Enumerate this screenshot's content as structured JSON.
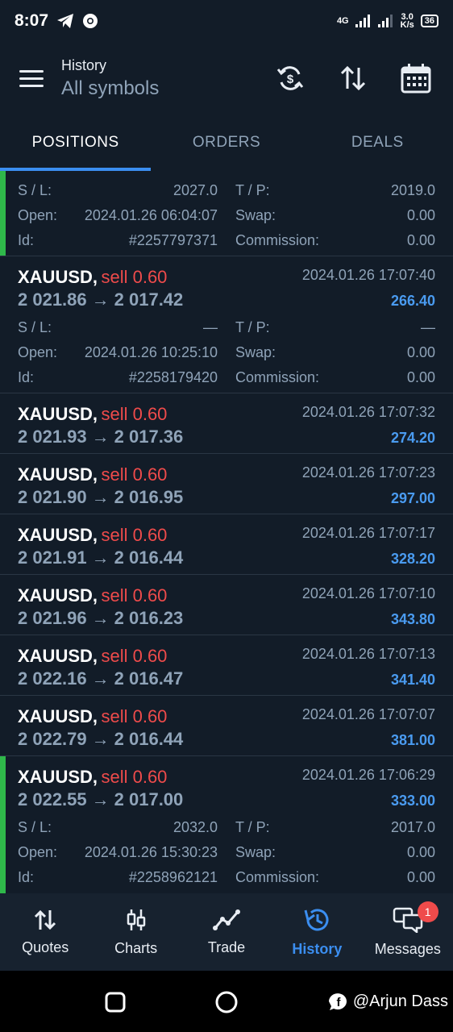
{
  "status_bar": {
    "time": "8:07",
    "network": "4G",
    "speed_value": "3.0",
    "speed_unit": "K/s",
    "battery": "36"
  },
  "header": {
    "subtitle": "History",
    "title": "All symbols"
  },
  "tabs": [
    {
      "label": "POSITIONS"
    },
    {
      "label": "ORDERS"
    },
    {
      "label": "DEALS"
    }
  ],
  "partial_row": {
    "sl_label": "S / L:",
    "sl": "2027.0",
    "tp_label": "T / P:",
    "tp": "2019.0",
    "open_label": "Open:",
    "open": "2024.01.26 06:04:07",
    "swap_label": "Swap:",
    "swap": "0.00",
    "id_label": "Id:",
    "id": "#2257797371",
    "commission_label": "Commission:",
    "commission": "0.00"
  },
  "positions": [
    {
      "symbol": "XAUUSD,",
      "side": "sell 0.60",
      "time": "2024.01.26 17:07:40",
      "open_price": "2 021.86",
      "close_price": "2 017.42",
      "profit": "266.40",
      "details": {
        "sl_label": "S / L:",
        "sl": "—",
        "tp_label": "T / P:",
        "tp": "—",
        "open_label": "Open:",
        "open": "2024.01.26 10:25:10",
        "swap_label": "Swap:",
        "swap": "0.00",
        "id_label": "Id:",
        "id": "#2258179420",
        "commission_label": "Commission:",
        "commission": "0.00"
      }
    },
    {
      "symbol": "XAUUSD,",
      "side": "sell 0.60",
      "time": "2024.01.26 17:07:32",
      "open_price": "2 021.93",
      "close_price": "2 017.36",
      "profit": "274.20"
    },
    {
      "symbol": "XAUUSD,",
      "side": "sell 0.60",
      "time": "2024.01.26 17:07:23",
      "open_price": "2 021.90",
      "close_price": "2 016.95",
      "profit": "297.00"
    },
    {
      "symbol": "XAUUSD,",
      "side": "sell 0.60",
      "time": "2024.01.26 17:07:17",
      "open_price": "2 021.91",
      "close_price": "2 016.44",
      "profit": "328.20"
    },
    {
      "symbol": "XAUUSD,",
      "side": "sell 0.60",
      "time": "2024.01.26 17:07:10",
      "open_price": "2 021.96",
      "close_price": "2 016.23",
      "profit": "343.80"
    },
    {
      "symbol": "XAUUSD,",
      "side": "sell 0.60",
      "time": "2024.01.26 17:07:13",
      "open_price": "2 022.16",
      "close_price": "2 016.47",
      "profit": "341.40"
    },
    {
      "symbol": "XAUUSD,",
      "side": "sell 0.60",
      "time": "2024.01.26 17:07:07",
      "open_price": "2 022.79",
      "close_price": "2 016.44",
      "profit": "381.00"
    },
    {
      "symbol": "XAUUSD,",
      "side": "sell 0.60",
      "time": "2024.01.26 17:06:29",
      "open_price": "2 022.55",
      "close_price": "2 017.00",
      "profit": "333.00",
      "details": {
        "sl_label": "S / L:",
        "sl": "2032.0",
        "tp_label": "T / P:",
        "tp": "2017.0",
        "open_label": "Open:",
        "open": "2024.01.26 15:30:23",
        "swap_label": "Swap:",
        "swap": "0.00",
        "id_label": "Id:",
        "id": "#2258962121",
        "commission_label": "Commission:",
        "commission": "0.00"
      }
    }
  ],
  "arrow_glyph": "→",
  "bottom_nav": [
    {
      "label": "Quotes",
      "icon": "quotes-arrows-icon"
    },
    {
      "label": "Charts",
      "icon": "candlestick-icon"
    },
    {
      "label": "Trade",
      "icon": "trend-line-icon"
    },
    {
      "label": "History",
      "icon": "history-clock-icon"
    },
    {
      "label": "Messages",
      "icon": "messages-icon",
      "badge": "1"
    }
  ],
  "watermark": "@Arjun Dass",
  "colors": {
    "background": "#121c28",
    "accent": "#3b8ef0",
    "sell": "#ef4b4b",
    "profit": "#4a9bf0",
    "open_bar": "#2fb84a",
    "muted": "#8fa3b8"
  }
}
